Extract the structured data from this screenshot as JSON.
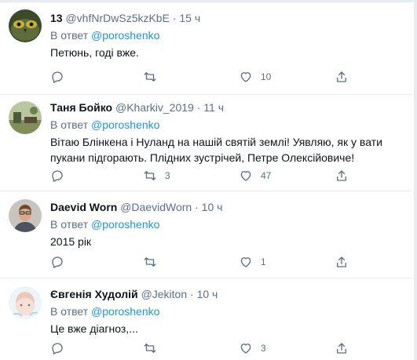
{
  "tweets": [
    {
      "name": "13",
      "handle": "@vhfNrDwSz5kzKbE",
      "dot": "·",
      "time": "15 ч",
      "reply_prefix": "В ответ",
      "reply_to": "@poroshenko",
      "text": "Петюнь, годі вже.",
      "retweets": "",
      "likes": "10",
      "avatar_icon": "owl-avatar"
    },
    {
      "name": "Таня Бойко",
      "handle": "@Kharkiv_2019",
      "dot": "·",
      "time": "11 ч",
      "reply_prefix": "В ответ",
      "reply_to": "@poroshenko",
      "text": "Вітаю Блінкена і Нуланд на нашій святій землі! Уявляю, як у вати пукани підгорають. Плідних зустрічей, Петре Олексійовиче!",
      "retweets": "3",
      "likes": "47",
      "avatar_icon": "landscape-avatar"
    },
    {
      "name": "Daevid Worn",
      "handle": "@DaevidWorn",
      "dot": "·",
      "time": "10 ч",
      "reply_prefix": "В ответ",
      "reply_to": "@poroshenko",
      "text": "2015 рік",
      "retweets": "",
      "likes": "1",
      "avatar_icon": "man-photo-avatar"
    },
    {
      "name": "Євгенія Худолій",
      "handle": "@Jekiton",
      "dot": "·",
      "time": "10 ч",
      "reply_prefix": "В ответ",
      "reply_to": "@poroshenko",
      "text": "Це вже діагноз,...",
      "retweets": "",
      "likes": "3",
      "avatar_icon": "illustration-avatar"
    }
  ],
  "colors": {
    "link": "#1b95e0",
    "muted": "#5b7083",
    "text": "#0f1419",
    "divider": "#e6ecf0"
  },
  "icons": [
    "reply-icon",
    "retweet-icon",
    "like-icon",
    "share-icon"
  ]
}
